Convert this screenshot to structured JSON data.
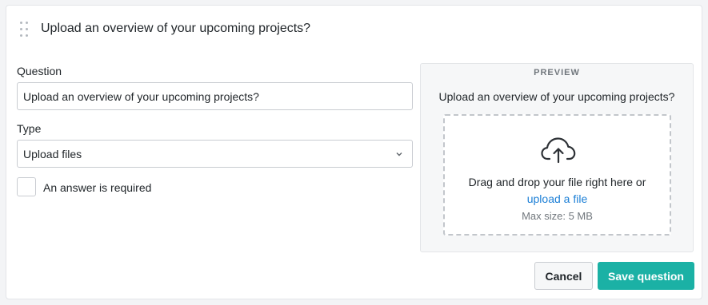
{
  "header": {
    "title": "Upload an overview of your upcoming projects?"
  },
  "form": {
    "question_label": "Question",
    "question_value": "Upload an overview of your upcoming projects?",
    "type_label": "Type",
    "type_value": "Upload files",
    "required_label": "An answer is required",
    "required_checked": false
  },
  "preview": {
    "label": "PREVIEW",
    "question": "Upload an overview of your upcoming projects?",
    "drop_text": "Drag and drop your file right here or",
    "link_text": "upload a file",
    "max_size": "Max size: 5 MB",
    "icon": "cloud-upload-icon"
  },
  "actions": {
    "cancel_label": "Cancel",
    "save_label": "Save question"
  },
  "colors": {
    "accent": "#1bb1a5",
    "link": "#1c7fd6"
  }
}
